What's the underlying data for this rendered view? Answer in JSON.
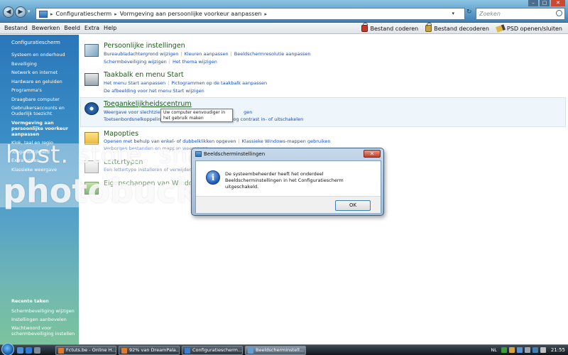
{
  "address": {
    "crumbs": [
      "Configuratiescherm",
      "Vormgeving aan persoonlijke voorkeur aanpassen"
    ],
    "search_placeholder": "Zoeken"
  },
  "menu": {
    "items": [
      "Bestand",
      "Bewerken",
      "Beeld",
      "Extra",
      "Help"
    ],
    "tools": [
      "Bestand coderen",
      "Bestand decoderen",
      "PSD openen/sluiten"
    ]
  },
  "sidebar": {
    "home": "Configuratiescherm",
    "links": [
      "Systeem en onderhoud",
      "Beveiliging",
      "Netwerk en internet",
      "Hardware en geluiden",
      "Programma's",
      "Draagbare computer",
      "Gebruikersaccounts en Ouderlijk toezicht",
      "Vormgeving aan persoonlijke voorkeur aanpassen",
      "Klok, taal en regio",
      "Toegankelijkheid",
      "Extra opties",
      "Klassieke weergave"
    ],
    "recent_heading": "Recente taken",
    "recent": [
      "Schermbeveiliging wijzigen",
      "Instellingen aanbevelen",
      "Wachtwoord voor schermbeveiliging instellen"
    ]
  },
  "categories": {
    "persoonlijk": {
      "title": "Persoonlijke instellingen",
      "row1": [
        "Bureaubladachtergrond wijzigen",
        "Kleuren aanpassen",
        "Beeldschermresolutie aanpassen"
      ],
      "row2": [
        "Schermbeveiliging wijzigen",
        "Het thema wijzigen"
      ]
    },
    "taakbalk": {
      "title": "Taakbalk en menu Start",
      "row1": [
        "Het menu Start aanpassen",
        "Pictogrammen op de taakbalk aanpassen"
      ],
      "row2": [
        "De afbeelding voor het menu Start wijzigen"
      ]
    },
    "toegankelijk": {
      "title": "Toegankelijkheidscentrum",
      "row1a": "Weergave voor slechtziend",
      "row1b": "gen",
      "row2a": "Toetsenbordsnelkoppeling",
      "row2b": "Hoog contrast in- of uitschakelen"
    },
    "mapopties": {
      "title": "Mapopties",
      "row1": [
        "Openen met behulp van enkel- of dubbelklikken opgeven",
        "Klassieke Windows-mappen gebruiken"
      ],
      "row2": [
        "Verborgen bestanden en mappen weergeven"
      ]
    },
    "lettertypen": {
      "title": "Lettertypen",
      "row1": [
        "Een lettertype installeren of verwijderen"
      ]
    },
    "sidebar_vista": {
      "title": "Eigenschappen van Windows Sidebar"
    }
  },
  "tooltip": "Uw computer eenvoudiger in het gebruik maken",
  "dialog": {
    "title": "Beeldscherminstellingen",
    "message": "De systeembeheerder heeft het onderdeel Beeldscherminstellingen in het Configuratiescherm uitgeschakeld.",
    "ok": "OK"
  },
  "watermark": {
    "line1": "host. store. share.",
    "line2": "photobucket"
  },
  "taskbar": {
    "tasks": [
      "Fctuts.be - Online H...",
      "92% van DreamPala...",
      "Configuratiescherm...",
      "Beeldscherminstell..."
    ],
    "lang": "NL",
    "clock": "21:55"
  },
  "colors": {
    "link": "#1e4fb0",
    "title_green": "#1d5a1a",
    "sidebar_top": "#2a76b9",
    "sidebar_bottom": "#7cc39c"
  }
}
